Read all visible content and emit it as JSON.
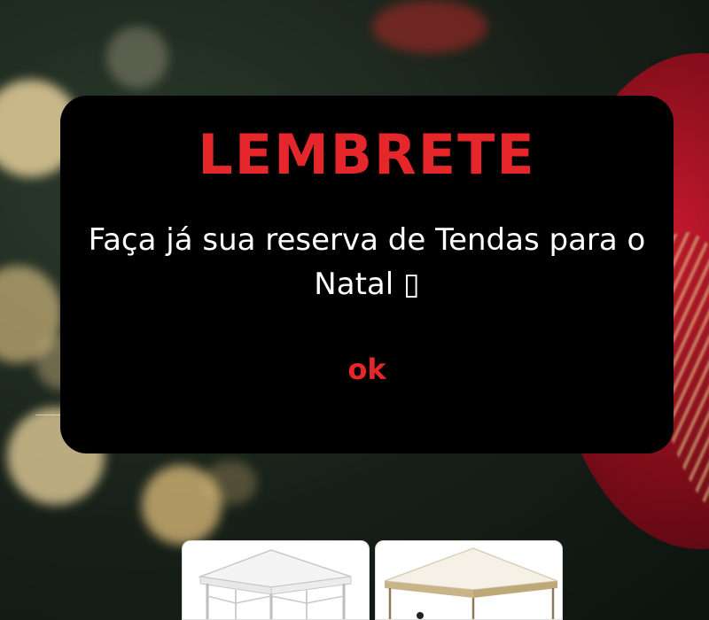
{
  "modal": {
    "title": "LEMBRETE",
    "message": "Faça já sua reserva de Tendas para o Natal ▯",
    "ok_label": "ok"
  },
  "products": [
    {
      "icon": "white-tent-image"
    },
    {
      "icon": "beige-tent-image"
    }
  ],
  "colors": {
    "accent": "#e5262a",
    "modal_background": "#000000",
    "text": "#ffffff"
  }
}
